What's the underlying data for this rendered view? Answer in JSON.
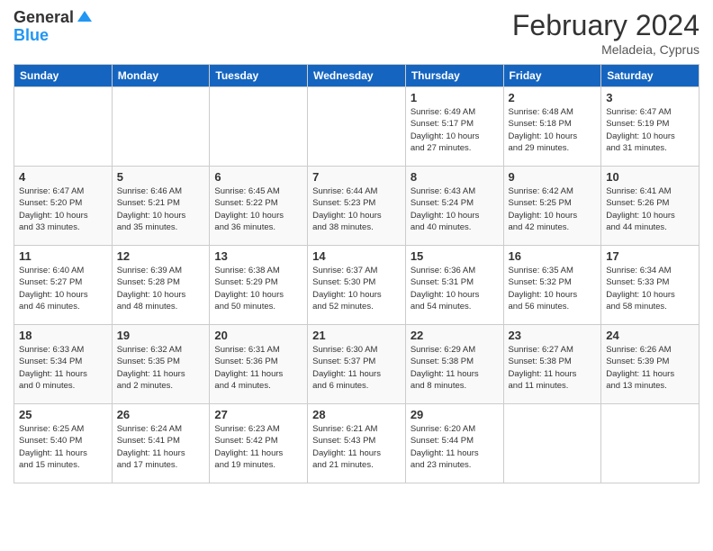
{
  "logo": {
    "general": "General",
    "blue": "Blue"
  },
  "title": "February 2024",
  "location": "Meladeia, Cyprus",
  "headers": [
    "Sunday",
    "Monday",
    "Tuesday",
    "Wednesday",
    "Thursday",
    "Friday",
    "Saturday"
  ],
  "weeks": [
    [
      {
        "day": "",
        "info": ""
      },
      {
        "day": "",
        "info": ""
      },
      {
        "day": "",
        "info": ""
      },
      {
        "day": "",
        "info": ""
      },
      {
        "day": "1",
        "info": "Sunrise: 6:49 AM\nSunset: 5:17 PM\nDaylight: 10 hours\nand 27 minutes."
      },
      {
        "day": "2",
        "info": "Sunrise: 6:48 AM\nSunset: 5:18 PM\nDaylight: 10 hours\nand 29 minutes."
      },
      {
        "day": "3",
        "info": "Sunrise: 6:47 AM\nSunset: 5:19 PM\nDaylight: 10 hours\nand 31 minutes."
      }
    ],
    [
      {
        "day": "4",
        "info": "Sunrise: 6:47 AM\nSunset: 5:20 PM\nDaylight: 10 hours\nand 33 minutes."
      },
      {
        "day": "5",
        "info": "Sunrise: 6:46 AM\nSunset: 5:21 PM\nDaylight: 10 hours\nand 35 minutes."
      },
      {
        "day": "6",
        "info": "Sunrise: 6:45 AM\nSunset: 5:22 PM\nDaylight: 10 hours\nand 36 minutes."
      },
      {
        "day": "7",
        "info": "Sunrise: 6:44 AM\nSunset: 5:23 PM\nDaylight: 10 hours\nand 38 minutes."
      },
      {
        "day": "8",
        "info": "Sunrise: 6:43 AM\nSunset: 5:24 PM\nDaylight: 10 hours\nand 40 minutes."
      },
      {
        "day": "9",
        "info": "Sunrise: 6:42 AM\nSunset: 5:25 PM\nDaylight: 10 hours\nand 42 minutes."
      },
      {
        "day": "10",
        "info": "Sunrise: 6:41 AM\nSunset: 5:26 PM\nDaylight: 10 hours\nand 44 minutes."
      }
    ],
    [
      {
        "day": "11",
        "info": "Sunrise: 6:40 AM\nSunset: 5:27 PM\nDaylight: 10 hours\nand 46 minutes."
      },
      {
        "day": "12",
        "info": "Sunrise: 6:39 AM\nSunset: 5:28 PM\nDaylight: 10 hours\nand 48 minutes."
      },
      {
        "day": "13",
        "info": "Sunrise: 6:38 AM\nSunset: 5:29 PM\nDaylight: 10 hours\nand 50 minutes."
      },
      {
        "day": "14",
        "info": "Sunrise: 6:37 AM\nSunset: 5:30 PM\nDaylight: 10 hours\nand 52 minutes."
      },
      {
        "day": "15",
        "info": "Sunrise: 6:36 AM\nSunset: 5:31 PM\nDaylight: 10 hours\nand 54 minutes."
      },
      {
        "day": "16",
        "info": "Sunrise: 6:35 AM\nSunset: 5:32 PM\nDaylight: 10 hours\nand 56 minutes."
      },
      {
        "day": "17",
        "info": "Sunrise: 6:34 AM\nSunset: 5:33 PM\nDaylight: 10 hours\nand 58 minutes."
      }
    ],
    [
      {
        "day": "18",
        "info": "Sunrise: 6:33 AM\nSunset: 5:34 PM\nDaylight: 11 hours\nand 0 minutes."
      },
      {
        "day": "19",
        "info": "Sunrise: 6:32 AM\nSunset: 5:35 PM\nDaylight: 11 hours\nand 2 minutes."
      },
      {
        "day": "20",
        "info": "Sunrise: 6:31 AM\nSunset: 5:36 PM\nDaylight: 11 hours\nand 4 minutes."
      },
      {
        "day": "21",
        "info": "Sunrise: 6:30 AM\nSunset: 5:37 PM\nDaylight: 11 hours\nand 6 minutes."
      },
      {
        "day": "22",
        "info": "Sunrise: 6:29 AM\nSunset: 5:38 PM\nDaylight: 11 hours\nand 8 minutes."
      },
      {
        "day": "23",
        "info": "Sunrise: 6:27 AM\nSunset: 5:38 PM\nDaylight: 11 hours\nand 11 minutes."
      },
      {
        "day": "24",
        "info": "Sunrise: 6:26 AM\nSunset: 5:39 PM\nDaylight: 11 hours\nand 13 minutes."
      }
    ],
    [
      {
        "day": "25",
        "info": "Sunrise: 6:25 AM\nSunset: 5:40 PM\nDaylight: 11 hours\nand 15 minutes."
      },
      {
        "day": "26",
        "info": "Sunrise: 6:24 AM\nSunset: 5:41 PM\nDaylight: 11 hours\nand 17 minutes."
      },
      {
        "day": "27",
        "info": "Sunrise: 6:23 AM\nSunset: 5:42 PM\nDaylight: 11 hours\nand 19 minutes."
      },
      {
        "day": "28",
        "info": "Sunrise: 6:21 AM\nSunset: 5:43 PM\nDaylight: 11 hours\nand 21 minutes."
      },
      {
        "day": "29",
        "info": "Sunrise: 6:20 AM\nSunset: 5:44 PM\nDaylight: 11 hours\nand 23 minutes."
      },
      {
        "day": "",
        "info": ""
      },
      {
        "day": "",
        "info": ""
      }
    ]
  ]
}
